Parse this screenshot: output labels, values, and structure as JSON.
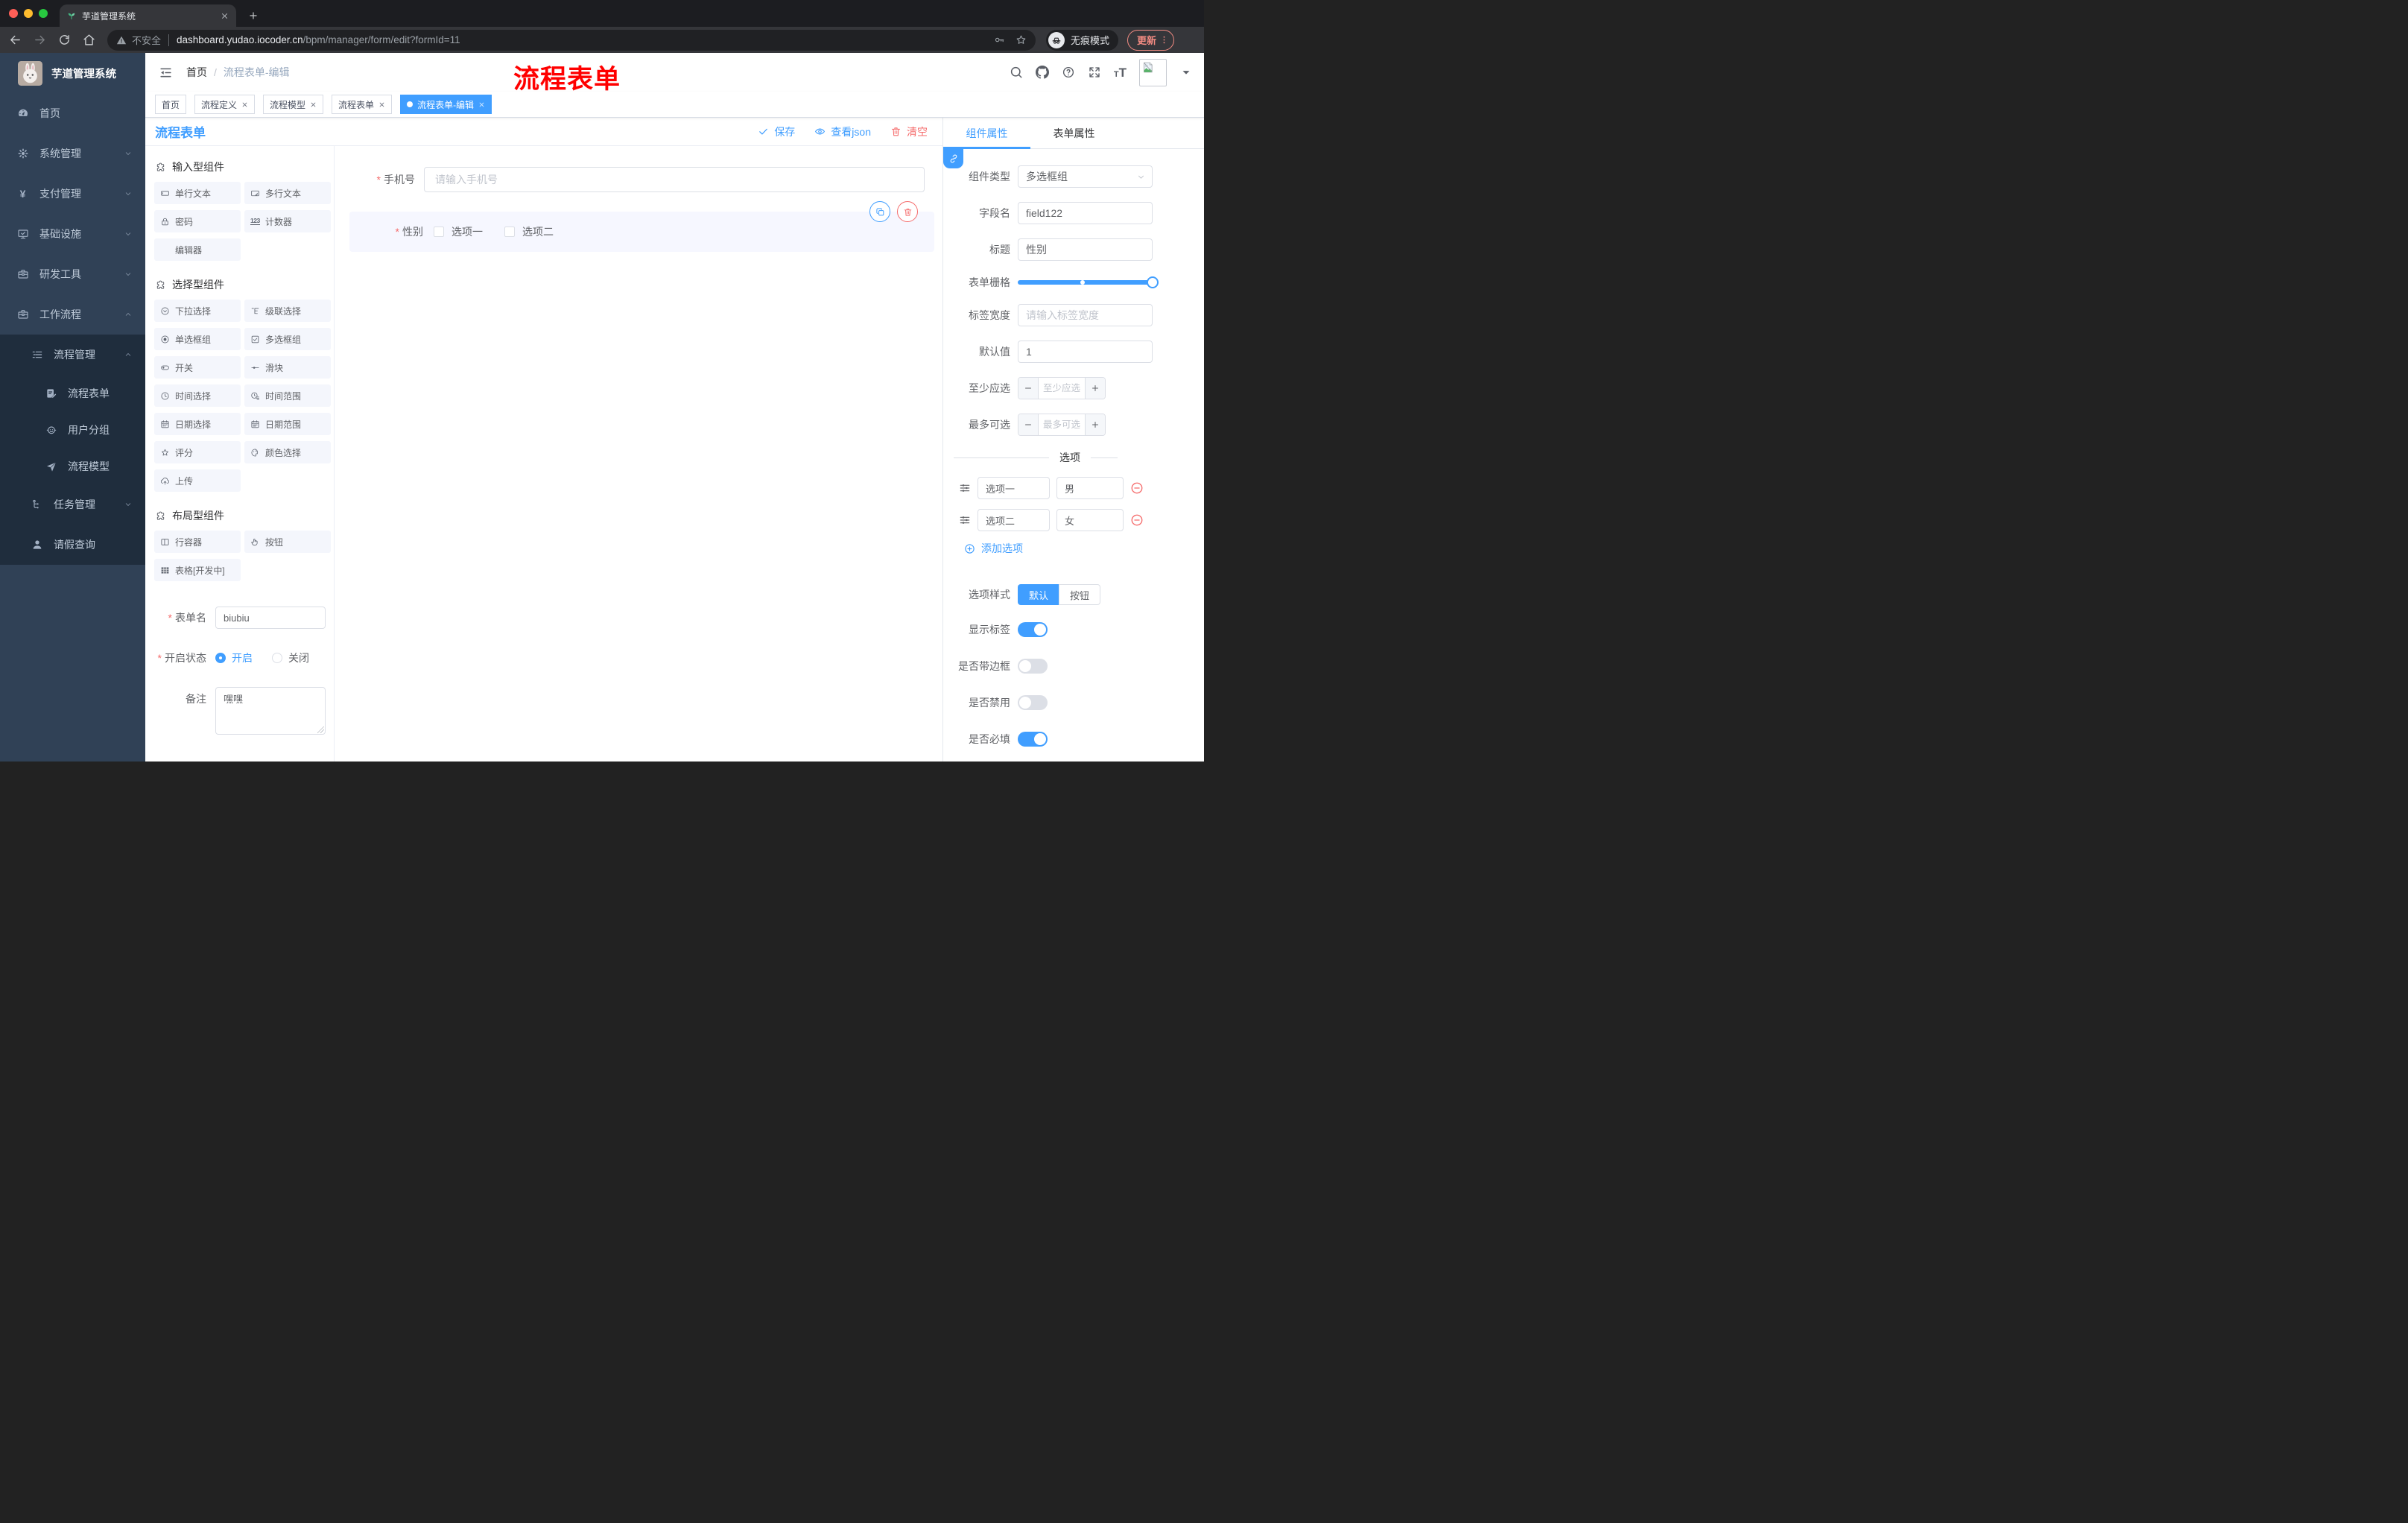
{
  "colors": {
    "accent": "#409eff",
    "danger": "#f56c6c",
    "sidebar_bg": "#304156",
    "submenu_bg": "#1f2d3d",
    "watermark_red": "#ff0000",
    "active_tag_bg": "#409eff",
    "component_item_bg": "#f4f6fc",
    "selected_block_bg": "#f6f7ff"
  },
  "browser": {
    "tab_title": "芋道管理系统",
    "security_label": "不安全",
    "url_host": "dashboard.yudao.iocoder.cn",
    "url_path": "/bpm/manager/form/edit?formId=11",
    "incognito_label": "无痕模式",
    "update_label": "更新"
  },
  "sidebar": {
    "logo_title": "芋道管理系统",
    "items": [
      {
        "label": "首页",
        "icon": "dashboard"
      },
      {
        "label": "系统管理",
        "icon": "gear"
      },
      {
        "label": "支付管理",
        "icon": "yen"
      },
      {
        "label": "基础设施",
        "icon": "monitor"
      },
      {
        "label": "研发工具",
        "icon": "toolbox"
      },
      {
        "label": "工作流程",
        "icon": "toolbox",
        "expanded": true
      }
    ],
    "submenu": {
      "process_mgmt": {
        "label": "流程管理",
        "icon": "list-tree",
        "expanded": true,
        "children": [
          {
            "label": "流程表单",
            "icon": "doc-edit"
          },
          {
            "label": "用户分组",
            "icon": "robot"
          },
          {
            "label": "流程模型",
            "icon": "send"
          }
        ]
      },
      "task_mgmt": {
        "label": "任务管理",
        "icon": "tree"
      },
      "leave_query": {
        "label": "请假查询",
        "icon": "person"
      }
    }
  },
  "header": {
    "breadcrumb": {
      "items": [
        "首页",
        "流程表单-编辑"
      ],
      "separator": "/"
    },
    "watermark": "流程表单"
  },
  "tags": [
    {
      "label": "首页",
      "closable": false,
      "active": false
    },
    {
      "label": "流程定义",
      "closable": true,
      "active": false
    },
    {
      "label": "流程模型",
      "closable": true,
      "active": false
    },
    {
      "label": "流程表单",
      "closable": true,
      "active": false
    },
    {
      "label": "流程表单-编辑",
      "closable": true,
      "active": true
    }
  ],
  "toolbar": {
    "title": "流程表单",
    "save_label": "保存",
    "view_json_label": "查看json",
    "clear_label": "清空"
  },
  "components_panel": {
    "sections": [
      {
        "title": "输入型组件",
        "items": [
          {
            "label": "单行文本",
            "icon": "input-box"
          },
          {
            "label": "多行文本",
            "icon": "textarea-box"
          },
          {
            "label": "密码",
            "icon": "lock"
          },
          {
            "label": "计数器",
            "icon": "counter-123"
          },
          {
            "label": "编辑器",
            "icon": ""
          }
        ]
      },
      {
        "title": "选择型组件",
        "items": [
          {
            "label": "下拉选择",
            "icon": "select-circle"
          },
          {
            "label": "级联选择",
            "icon": "cascader-tree"
          },
          {
            "label": "单选框组",
            "icon": "radio-group"
          },
          {
            "label": "多选框组",
            "icon": "checkbox-group"
          },
          {
            "label": "开关",
            "icon": "switch"
          },
          {
            "label": "滑块",
            "icon": "slider"
          },
          {
            "label": "时间选择",
            "icon": "clock"
          },
          {
            "label": "时间范围",
            "icon": "clock-range"
          },
          {
            "label": "日期选择",
            "icon": "calendar"
          },
          {
            "label": "日期范围",
            "icon": "calendar-range"
          },
          {
            "label": "评分",
            "icon": "star-rate"
          },
          {
            "label": "颜色选择",
            "icon": "palette"
          },
          {
            "label": "上传",
            "icon": "cloud-upload"
          }
        ]
      },
      {
        "title": "布局型组件",
        "items": [
          {
            "label": "行容器",
            "icon": "row-container"
          },
          {
            "label": "按钮",
            "icon": "click-hand"
          },
          {
            "label": "表格[开发中]",
            "icon": "table-grid"
          }
        ]
      }
    ],
    "form": {
      "name_label": "表单名",
      "name_value": "biubiu",
      "status_label": "开启状态",
      "status_options": [
        {
          "label": "开启",
          "selected": true
        },
        {
          "label": "关闭",
          "selected": false
        }
      ],
      "remark_label": "备注",
      "remark_value": "嘿嘿"
    }
  },
  "canvas": {
    "phone": {
      "label": "手机号",
      "required": true,
      "placeholder": "请输入手机号"
    },
    "gender": {
      "label": "性别",
      "required": true,
      "options": [
        "选项一",
        "选项二"
      ]
    }
  },
  "props_panel": {
    "tabs": [
      {
        "label": "组件属性",
        "active": true
      },
      {
        "label": "表单属性",
        "active": false
      }
    ],
    "component_type": {
      "label": "组件类型",
      "value": "多选框组"
    },
    "field_name": {
      "label": "字段名",
      "value": "field122"
    },
    "title_field": {
      "label": "标题",
      "value": "性别"
    },
    "form_grid": {
      "label": "表单栅格",
      "fill_percent": 100,
      "mark_percent": 48
    },
    "label_width": {
      "label": "标签宽度",
      "placeholder": "请输入标签宽度"
    },
    "default_value": {
      "label": "默认值",
      "value": "1"
    },
    "min_select": {
      "label": "至少应选",
      "placeholder": "至少应选"
    },
    "max_select": {
      "label": "最多可选",
      "placeholder": "最多可选"
    },
    "options_divider": "选项",
    "options": [
      {
        "label": "选项一",
        "value": "男"
      },
      {
        "label": "选项二",
        "value": "女"
      }
    ],
    "add_option_label": "添加选项",
    "option_style": {
      "label": "选项样式",
      "options": [
        {
          "label": "默认",
          "active": true
        },
        {
          "label": "按钮",
          "active": false
        }
      ]
    },
    "switches": [
      {
        "label": "显示标签",
        "on": true
      },
      {
        "label": "是否带边框",
        "on": false
      },
      {
        "label": "是否禁用",
        "on": false
      },
      {
        "label": "是否必填",
        "on": true
      }
    ]
  }
}
